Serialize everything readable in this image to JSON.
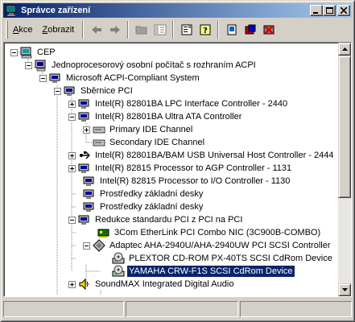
{
  "window": {
    "title": "Správce zařízení"
  },
  "toolbar": {
    "menu": [
      {
        "label": "Akce",
        "accel": "A",
        "rest": "kce"
      },
      {
        "label": "Zobrazit",
        "accel": "Z",
        "rest": "obrazit"
      }
    ],
    "tools": [
      "back-icon",
      "forward-icon",
      "up-folder-icon",
      "show-hide-tree-icon",
      "properties-icon",
      "help-icon",
      "scan-hardware-icon",
      "update-driver-icon",
      "uninstall-icon"
    ]
  },
  "tree": {
    "items": [
      {
        "label": "CEP",
        "icon": "computer-root-icon"
      },
      {
        "label": "Jednoprocesorový osobní počítač s rozhraním ACPI",
        "icon": "computer-icon"
      },
      {
        "label": "Microsoft ACPI-Compliant System",
        "icon": "system-device-icon"
      },
      {
        "label": "Sběrnice PCI",
        "icon": "system-device-icon"
      },
      {
        "label": "Intel(R) 82801BA LPC Interface Controller - 2440",
        "icon": "system-device-icon"
      },
      {
        "label": "Intel(R) 82801BA Ultra ATA Controller",
        "icon": "system-device-icon"
      },
      {
        "label": "Primary IDE Channel",
        "icon": "ide-channel-icon"
      },
      {
        "label": "Secondary IDE Channel",
        "icon": "ide-channel-icon"
      },
      {
        "label": "Intel(R) 82801BA/BAM USB Universal Host Controller - 2444",
        "icon": "usb-icon"
      },
      {
        "label": "Intel(R) 82815 Processor to AGP Controller - 1131",
        "icon": "system-device-icon"
      },
      {
        "label": "Intel(R) 82815 Processor to I/O Controller - 1130",
        "icon": "system-device-icon"
      },
      {
        "label": "Prostředky základní desky",
        "icon": "system-device-icon"
      },
      {
        "label": "Prostředky základní desky",
        "icon": "system-device-icon"
      },
      {
        "label": "Redukce standardu PCI z PCI na PCI",
        "icon": "system-device-icon"
      },
      {
        "label": "3Com EtherLink PCI Combo NIC (3C900B-COMBO)",
        "icon": "network-adapter-icon"
      },
      {
        "label": "Adaptec AHA-2940U/AHA-2940UW PCI SCSI Controller",
        "icon": "scsi-controller-icon"
      },
      {
        "label": "PLEXTOR CD-ROM PX-40TS SCSI CdRom Device",
        "icon": "cdrom-icon"
      },
      {
        "label": "YAMAHA CRW-F1S SCSI CdRom Device",
        "icon": "cdrom-icon"
      },
      {
        "label": "SoundMAX Integrated Digital Audio",
        "icon": "audio-icon"
      }
    ]
  },
  "colors": {
    "title_gradient_start": "#0a246a",
    "title_gradient_end": "#a6caf0",
    "selection": "#0a246a",
    "face": "#d4d0c8"
  }
}
